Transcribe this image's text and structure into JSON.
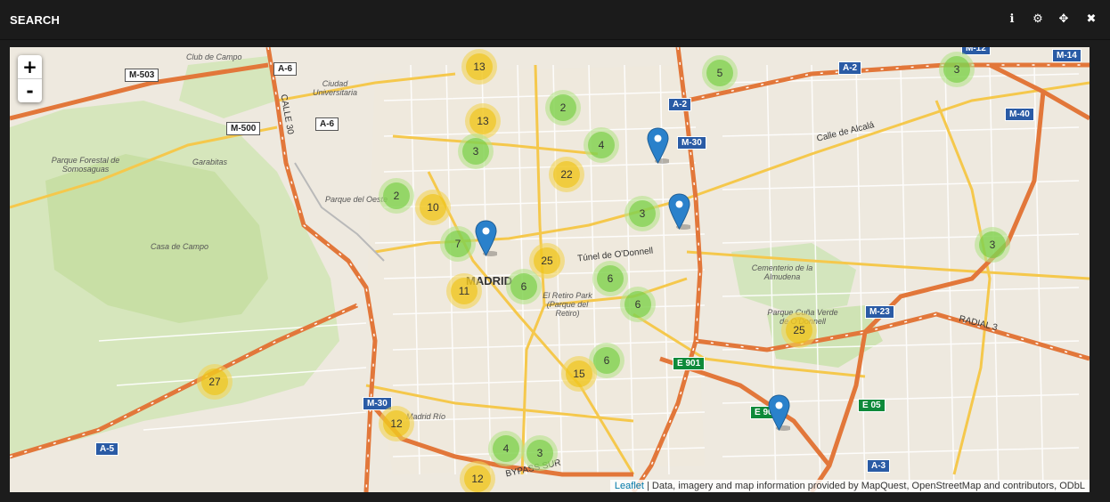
{
  "window": {
    "title": "SEARCH"
  },
  "toolbar": {
    "info_icon": "info-icon",
    "settings_icon": "gear-icon",
    "move_icon": "move-icon",
    "close_icon": "close-icon",
    "glyphs": {
      "info": "ℹ",
      "settings": "⚙",
      "move": "✥",
      "close": "✖"
    }
  },
  "zoom": {
    "in_label": "+",
    "out_label": "-"
  },
  "clusters": [
    {
      "count": "13",
      "size": "medium"
    },
    {
      "count": "5",
      "size": "small"
    },
    {
      "count": "3",
      "size": "small"
    },
    {
      "count": "2",
      "size": "small"
    },
    {
      "count": "13",
      "size": "medium"
    },
    {
      "count": "4",
      "size": "small"
    },
    {
      "count": "3",
      "size": "small"
    },
    {
      "count": "22",
      "size": "medium"
    },
    {
      "count": "2",
      "size": "small"
    },
    {
      "count": "10",
      "size": "medium"
    },
    {
      "count": "3",
      "size": "small"
    },
    {
      "count": "7",
      "size": "small"
    },
    {
      "count": "3",
      "size": "small"
    },
    {
      "count": "25",
      "size": "medium"
    },
    {
      "count": "11",
      "size": "medium"
    },
    {
      "count": "6",
      "size": "small"
    },
    {
      "count": "6",
      "size": "small"
    },
    {
      "count": "6",
      "size": "small"
    },
    {
      "count": "25",
      "size": "medium"
    },
    {
      "count": "27",
      "size": "medium"
    },
    {
      "count": "6",
      "size": "small"
    },
    {
      "count": "15",
      "size": "medium"
    },
    {
      "count": "12",
      "size": "medium"
    },
    {
      "count": "4",
      "size": "small"
    },
    {
      "count": "3",
      "size": "small"
    },
    {
      "count": "12",
      "size": "medium"
    }
  ],
  "markers": [
    {
      "name": "marker-1"
    },
    {
      "name": "marker-2"
    },
    {
      "name": "marker-3"
    },
    {
      "name": "marker-4"
    }
  ],
  "colors": {
    "cluster_small_outer": "#b5e28c",
    "cluster_small_inner": "#6ecc39",
    "cluster_medium_outer": "#f1d357",
    "cluster_medium_inner": "#f0c20c",
    "marker": "#2a81cb",
    "highway": "#e2773a",
    "road": "#f5c84c",
    "park": "#c8dfa5"
  },
  "labels": {
    "city": "MADRID",
    "places": [
      "Club de Campo",
      "Ciudad Universitaria",
      "Parque Forestal de Somosaguas",
      "Garabitas",
      "Parque del Oeste",
      "Casa de Campo",
      "El Retiro Park (Parque del Retiro)",
      "Cementerio de la Almudena",
      "Parque Cuña Verde de O'Donnell",
      "Madrid Río"
    ],
    "streets": [
      "Calle de Alcalá",
      "Túnel de O'Donnell",
      "RADIAL 3",
      "BYPASS SUR",
      "CALLE 30"
    ],
    "road_shields": {
      "blue": [
        "A-2",
        "A-2",
        "M-30",
        "M-14",
        "M-40",
        "M-23",
        "M-30",
        "A-5",
        "A-3",
        "M-12"
      ],
      "green": [
        "E 901",
        "E 05",
        "E 90"
      ],
      "white": [
        "M-503",
        "A-6",
        "A-6",
        "M-500"
      ]
    }
  },
  "attribution": {
    "link": "Leaflet",
    "text": " | Data, imagery and map information provided by MapQuest, OpenStreetMap and contributors, ODbL"
  }
}
